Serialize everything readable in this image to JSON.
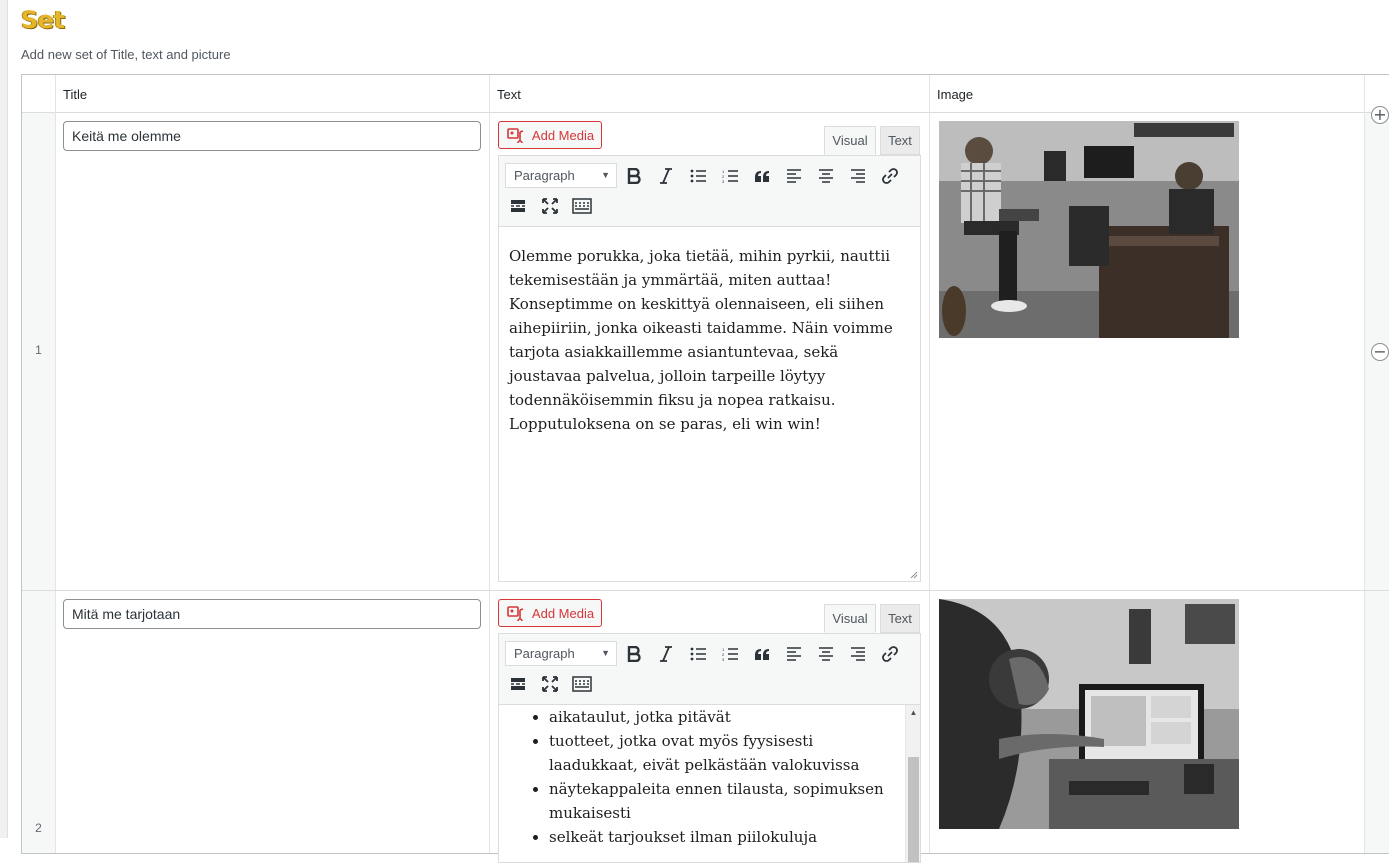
{
  "section": {
    "title": "Set",
    "description": "Add new set of Title, text and picture"
  },
  "columns": {
    "title": "Title",
    "text": "Text",
    "image": "Image"
  },
  "editor_ui": {
    "add_media": "Add Media",
    "tab_visual": "Visual",
    "tab_text": "Text",
    "format": "Paragraph"
  },
  "rows": [
    {
      "number": "1",
      "title_value": "Keitä me olemme",
      "paragraphs": [
        "Olemme porukka, joka tietää, mihin pyrkii, nauttii tekemisestään ja ymmärtää, miten auttaa! Konseptimme on keskittyä olennaiseen, eli siihen aihepiiriin, jonka oikeasti taidamme. Näin voimme tarjota asiakkaillemme asiantuntevaa, sekä joustavaa palvelua, jolloin tarpeille löytyy todennäköisemmin fiksu ja nopea ratkaisu. Lopputuloksena on se paras, eli win win!"
      ]
    },
    {
      "number": "2",
      "title_value": "Mitä me tarjotaan",
      "bullets": [
        "aikataulut, jotka pitävät",
        "tuotteet, jotka ovat myös fyysisesti laadukkaat, eivät pelkästään valokuvissa",
        "näytekappaleita ennen tilausta, sopimuksen mukaisesti",
        "selkeät tarjoukset ilman piilokuluja"
      ]
    }
  ],
  "icons": [
    "add-media-icon",
    "bold-icon",
    "italic-icon",
    "bulleted-list-icon",
    "numbered-list-icon",
    "blockquote-icon",
    "align-left-icon",
    "align-center-icon",
    "align-right-icon",
    "link-icon",
    "read-more-icon",
    "fullscreen-icon",
    "toolbar-toggle-icon",
    "add-row-icon",
    "remove-row-icon"
  ],
  "colors": {
    "heading": "#e5b62b",
    "media_button": "#d63638"
  }
}
